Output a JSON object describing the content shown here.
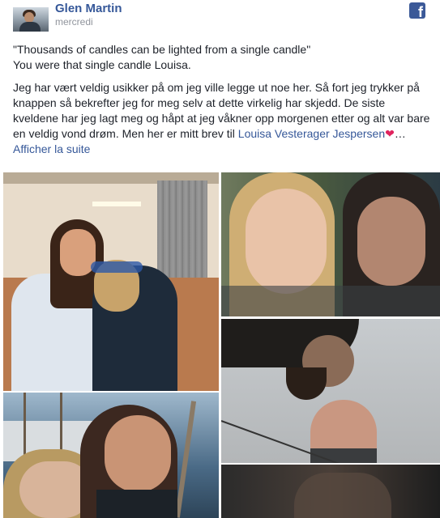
{
  "author": {
    "name": "Glen Martin",
    "date": "mercredi"
  },
  "header_icons": {
    "avatar": "profile-photo",
    "facebook": "facebook-logo-icon"
  },
  "post": {
    "quote_line1": "\"Thousands of candles can be lighted from a single candle\"",
    "quote_line2": "You were that single candle Louisa.",
    "body_text": "Jeg har vært veldig usikker på om jeg ville legge ut noe her. Så fort jeg trykker på knappen så bekrefter jeg for meg selv at dette virkelig har skjedd. De siste kveldene har jeg lagt meg og håpt at jeg våkner opp morgenen etter og alt var bare en veldig vond drøm. Men her er mitt brev til ",
    "mention": "Louisa Vesterager Jespersen",
    "heart": "❤",
    "ellipsis": "… ",
    "see_more": "Afficher la suite"
  },
  "photos": [
    {
      "name": "photo-couple-hug"
    },
    {
      "name": "photo-selfie-blurry"
    },
    {
      "name": "photo-upside-down-faces"
    },
    {
      "name": "photo-harbor-selfie"
    },
    {
      "name": "photo-dark-cropped"
    }
  ],
  "colors": {
    "link": "#365899",
    "meta": "#90949c",
    "text": "#1d2129",
    "facebook": "#3b5998",
    "heart": "#e0245e"
  }
}
